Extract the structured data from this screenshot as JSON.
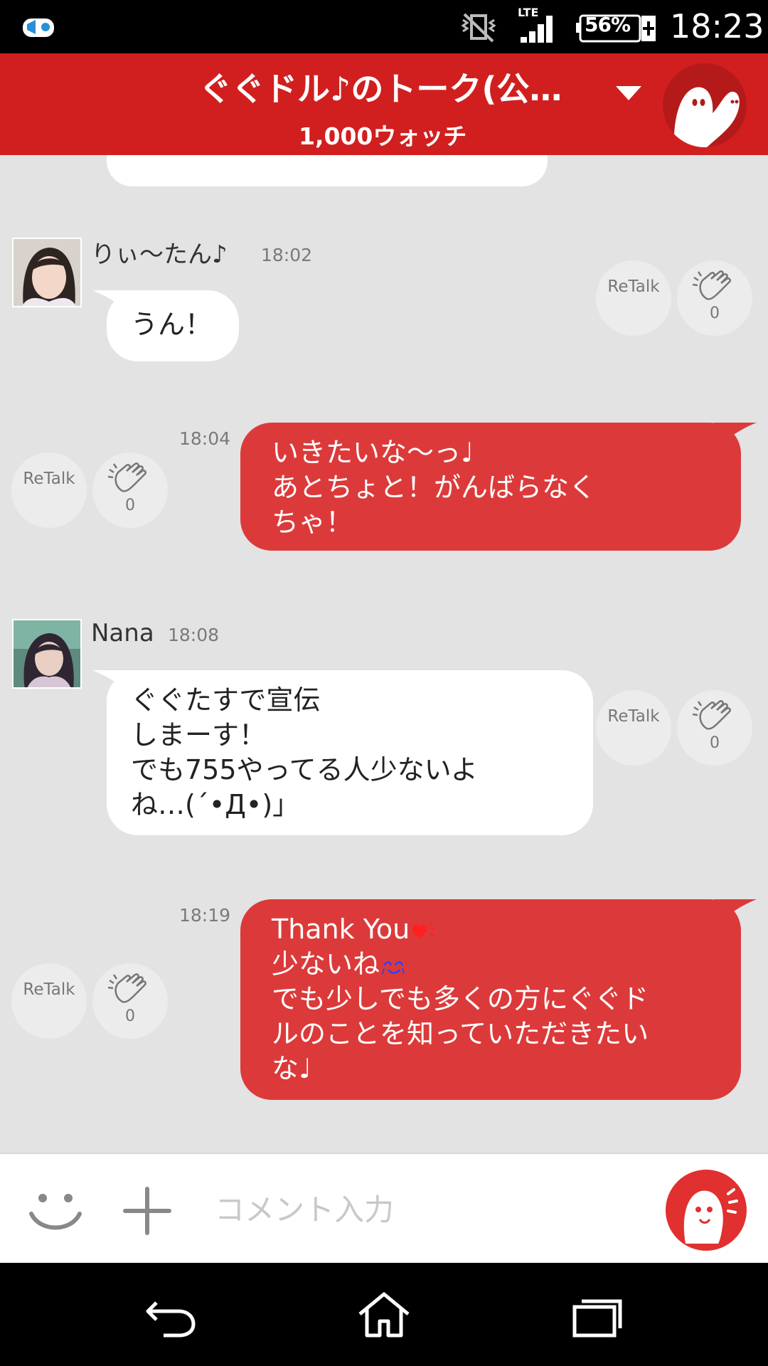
{
  "status_bar": {
    "network": "LTE",
    "battery": "56%",
    "time": "18:23"
  },
  "header": {
    "title": "ぐぐドル♪のトーク(公…",
    "subtitle": "1,000ウォッチ"
  },
  "actions": {
    "retalk_label": "ReTalk",
    "clap_count": "0"
  },
  "messages": [
    {
      "type": "incoming",
      "sender": "りぃ～たん♪",
      "time": "18:02",
      "lines": [
        "うん！"
      ]
    },
    {
      "type": "outgoing",
      "time": "18:04",
      "lines": [
        "いきたいな～っ♩",
        "あとちょと！がんばらなく",
        "ちゃ！"
      ]
    },
    {
      "type": "incoming",
      "sender": "Nana",
      "time": "18:08",
      "lines": [
        "ぐぐたすで宣伝",
        "しまーす！",
        "でも755やってる人少ないよ",
        "ね…(´•Д•)」"
      ]
    },
    {
      "type": "outgoing",
      "time": "18:19",
      "lines": [
        "Thank You",
        "少ないね",
        "でも少しでも多くの方にぐぐド",
        "ルのことを知っていただきたい",
        "な♩"
      ]
    }
  ],
  "input": {
    "placeholder": "コメント入力"
  },
  "colors": {
    "brand_red": "#d11f1f",
    "bubble_red": "#dc3a3a",
    "chat_bg": "#e3e3e3"
  }
}
